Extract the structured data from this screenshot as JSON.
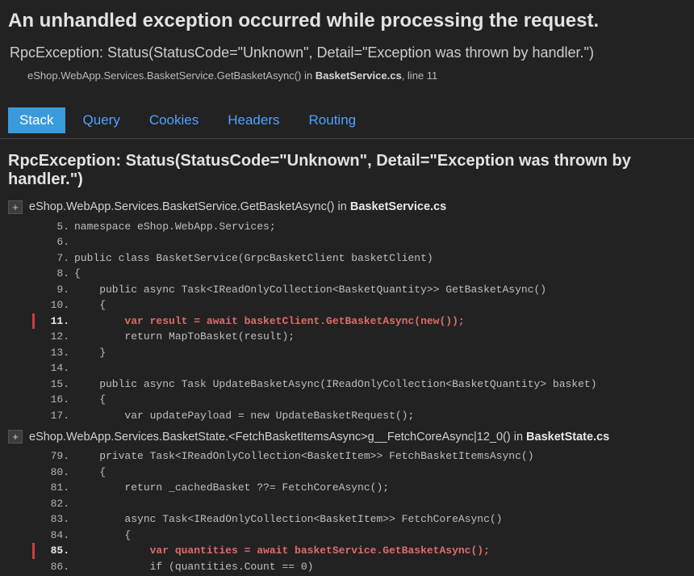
{
  "header": {
    "title": "An unhandled exception occurred while processing the request.",
    "subtitle": "RpcException: Status(StatusCode=\"Unknown\", Detail=\"Exception was thrown by handler.\")",
    "location_prefix": "eShop.WebApp.Services.BasketService.GetBasketAsync() in ",
    "location_file": "BasketService.cs",
    "location_suffix": ", line 11"
  },
  "tabs": [
    {
      "id": "stack",
      "label": "Stack",
      "active": true
    },
    {
      "id": "query",
      "label": "Query",
      "active": false
    },
    {
      "id": "cookies",
      "label": "Cookies",
      "active": false
    },
    {
      "id": "headers",
      "label": "Headers",
      "active": false
    },
    {
      "id": "routing",
      "label": "Routing",
      "active": false
    }
  ],
  "exception_heading": "RpcException: Status(StatusCode=\"Unknown\", Detail=\"Exception was thrown by handler.\")",
  "frames": [
    {
      "expand": "+",
      "method_prefix": "eShop.WebApp.Services.BasketService.GetBasketAsync() in ",
      "file": "BasketService.cs",
      "method_suffix": "",
      "code": [
        {
          "n": "5.",
          "t": "namespace eShop.WebApp.Services;",
          "hl": false
        },
        {
          "n": "6.",
          "t": "",
          "hl": false
        },
        {
          "n": "7.",
          "t": "public class BasketService(GrpcBasketClient basketClient)",
          "hl": false
        },
        {
          "n": "8.",
          "t": "{",
          "hl": false
        },
        {
          "n": "9.",
          "t": "    public async Task<IReadOnlyCollection<BasketQuantity>> GetBasketAsync()",
          "hl": false
        },
        {
          "n": "10.",
          "t": "    {",
          "hl": false
        },
        {
          "n": "11.",
          "t": "        var result = await basketClient.GetBasketAsync(new());",
          "hl": true
        },
        {
          "n": "12.",
          "t": "        return MapToBasket(result);",
          "hl": false
        },
        {
          "n": "13.",
          "t": "    }",
          "hl": false
        },
        {
          "n": "14.",
          "t": "",
          "hl": false
        },
        {
          "n": "15.",
          "t": "    public async Task UpdateBasketAsync(IReadOnlyCollection<BasketQuantity> basket)",
          "hl": false
        },
        {
          "n": "16.",
          "t": "    {",
          "hl": false
        },
        {
          "n": "17.",
          "t": "        var updatePayload = new UpdateBasketRequest();",
          "hl": false
        }
      ]
    },
    {
      "expand": "+",
      "method_prefix": "eShop.WebApp.Services.BasketState.<FetchBasketItemsAsync>g__FetchCoreAsync|12_0() in ",
      "file": "BasketState.cs",
      "method_suffix": "",
      "code": [
        {
          "n": "79.",
          "t": "    private Task<IReadOnlyCollection<BasketItem>> FetchBasketItemsAsync()",
          "hl": false
        },
        {
          "n": "80.",
          "t": "    {",
          "hl": false
        },
        {
          "n": "81.",
          "t": "        return _cachedBasket ??= FetchCoreAsync();",
          "hl": false
        },
        {
          "n": "82.",
          "t": "",
          "hl": false
        },
        {
          "n": "83.",
          "t": "        async Task<IReadOnlyCollection<BasketItem>> FetchCoreAsync()",
          "hl": false
        },
        {
          "n": "84.",
          "t": "        {",
          "hl": false
        },
        {
          "n": "85.",
          "t": "            var quantities = await basketService.GetBasketAsync();",
          "hl": true
        },
        {
          "n": "86.",
          "t": "            if (quantities.Count == 0)",
          "hl": false
        }
      ]
    }
  ]
}
